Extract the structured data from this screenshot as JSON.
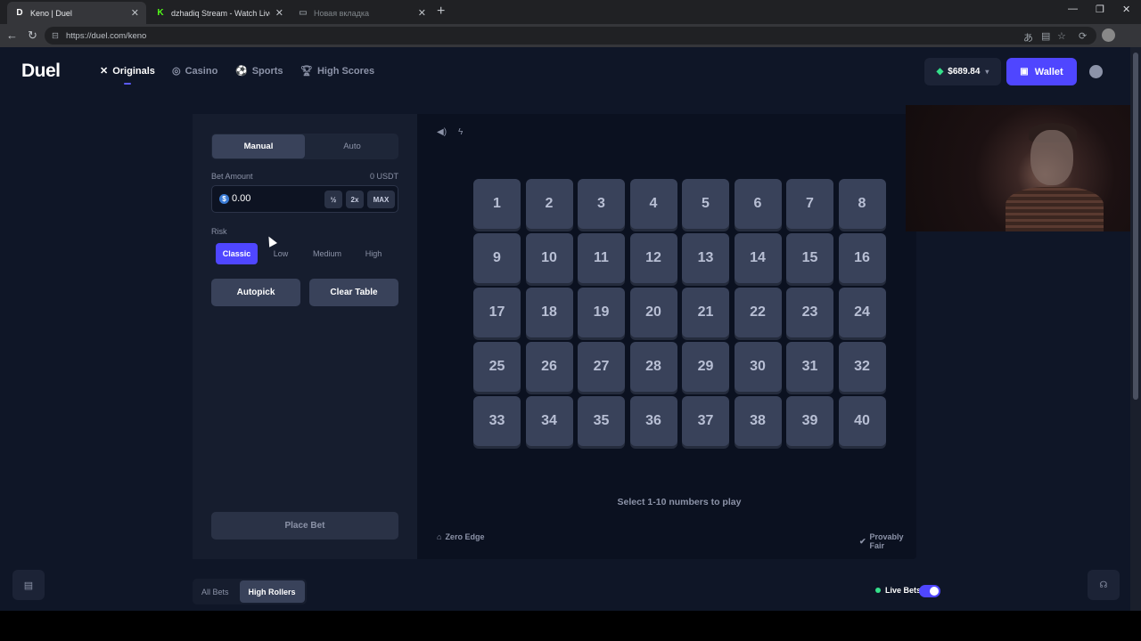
{
  "browser": {
    "tabs": [
      {
        "label": "Keno | Duel",
        "favicon": "D",
        "active": true
      },
      {
        "label": "dzhadiq Stream - Watch Live on Ki",
        "favicon": "K"
      },
      {
        "label": "Новая вкладка",
        "favicon": "page-icon"
      }
    ],
    "url": "https://duel.com/keno"
  },
  "header": {
    "logo": "Duel",
    "nav": [
      {
        "label": "Originals",
        "icon": "originals-icon",
        "active": true
      },
      {
        "label": "Casino",
        "icon": "casino-icon"
      },
      {
        "label": "Sports",
        "icon": "sports-icon"
      },
      {
        "label": "High Scores",
        "icon": "trophy-icon"
      }
    ],
    "balance": "$689.84",
    "wallet_label": "Wallet"
  },
  "sidebar": {
    "modes": [
      "Manual",
      "Auto"
    ],
    "bet_amount_label": "Bet Amount",
    "bet_amount_currency": "0 USDT",
    "bet_value": "0.00",
    "half_label": "½",
    "double_label": "2x",
    "max_label": "MAX",
    "risk_label": "Risk",
    "risk_options": [
      "Classic",
      "Low",
      "Medium",
      "High"
    ],
    "autopick_label": "Autopick",
    "clear_label": "Clear Table",
    "place_bet_label": "Place Bet"
  },
  "board": {
    "numbers": [
      "1",
      "2",
      "3",
      "4",
      "5",
      "6",
      "7",
      "8",
      "9",
      "10",
      "11",
      "12",
      "13",
      "14",
      "15",
      "16",
      "17",
      "18",
      "19",
      "20",
      "21",
      "22",
      "23",
      "24",
      "25",
      "26",
      "27",
      "28",
      "29",
      "30",
      "31",
      "32",
      "33",
      "34",
      "35",
      "36",
      "37",
      "38",
      "39",
      "40"
    ],
    "hint": "Select 1-10 numbers to play",
    "zero_edge": "Zero Edge",
    "provably_fair": "Provably Fair"
  },
  "bottom": {
    "tabs": [
      "All Bets",
      "High Rollers"
    ],
    "live_bets": "Live Bets"
  },
  "colors": {
    "accent": "#4f46ff",
    "live": "#35e08a"
  }
}
